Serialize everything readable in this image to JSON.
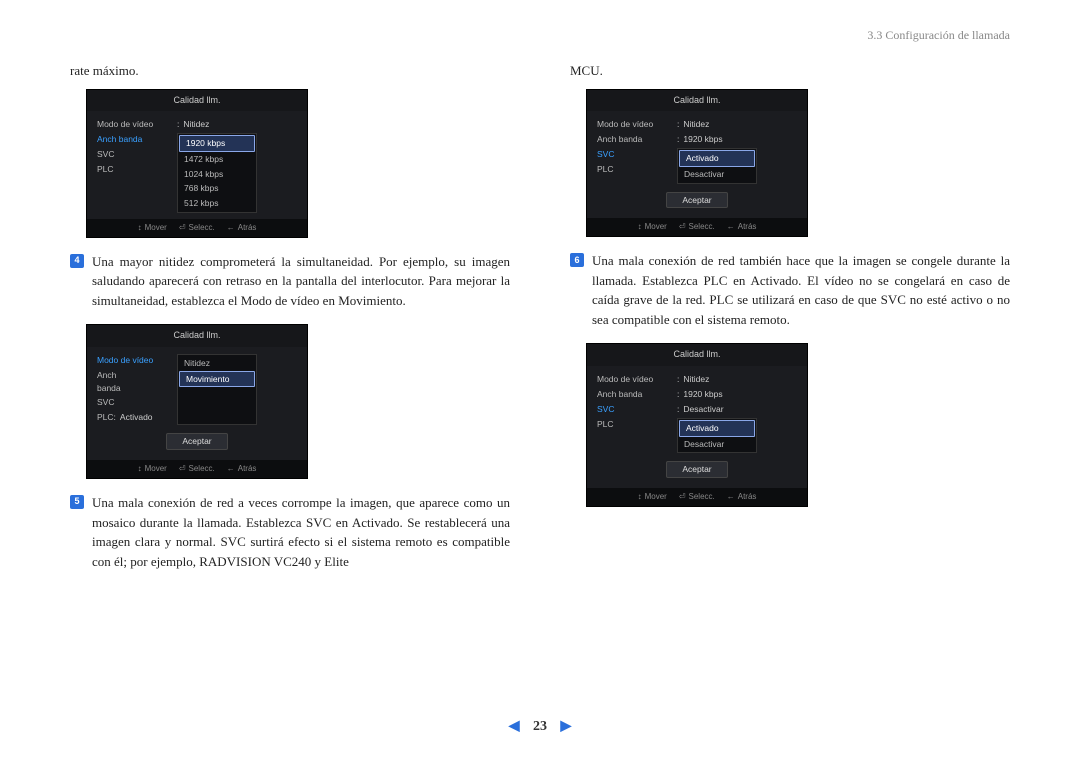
{
  "header": {
    "section": "3.3 Configuración de llamada"
  },
  "leftCol": {
    "lead1": "rate máximo.",
    "shot1": {
      "title": "Calidad  llm.",
      "rows": [
        {
          "label": "Modo de vídeo",
          "value": "Nitidez",
          "hl": false
        },
        {
          "label": "Anch banda",
          "value": "",
          "hl": true
        }
      ],
      "dropdown": [
        "1920 kbps",
        "1472 kbps",
        "1024 kbps",
        "768 kbps",
        "512 kbps"
      ],
      "selectedIndex": 0,
      "extraRows": [
        {
          "label": "SVC",
          "value": ""
        },
        {
          "label": "PLC",
          "value": ""
        }
      ],
      "footer": {
        "move": "Mover",
        "select": "Selecc.",
        "back": "Atrás"
      }
    },
    "step4": {
      "num": "4",
      "text": "Una mayor nitidez comprometerá la simultaneidad. Por ejemplo, su imagen saludando aparecerá con retraso en la pantalla del interlocutor. Para mejorar la simultaneidad, establezca el Modo de vídeo en Movi­miento."
    },
    "shot2": {
      "title": "Calidad  llm.",
      "rows": [
        {
          "label": "Modo de vídeo",
          "value": "",
          "hl": true
        }
      ],
      "dropdown": [
        "Nitidez",
        "Movimiento"
      ],
      "selectedIndex": 1,
      "extraRows": [
        {
          "label": "Anch banda",
          "value": ""
        },
        {
          "label": "SVC",
          "value": ""
        },
        {
          "label": "PLC",
          "value": "Activado"
        }
      ],
      "accept": "Aceptar",
      "footer": {
        "move": "Mover",
        "select": "Selecc.",
        "back": "Atrás"
      }
    },
    "step5": {
      "num": "5",
      "text": "Una mala conexión de red a veces corrompe la imagen, que aparece como un mosaico durante la llamada. Establezca SVC en Activado. Se restablecerá una imagen clara y normal. SVC surtirá efecto si el sistema remoto es compatible con él; por ejemplo, RADVISION VC240 y Elite"
    }
  },
  "rightCol": {
    "lead1": "MCU.",
    "shot3": {
      "title": "Calidad  llm.",
      "rows": [
        {
          "label": "Modo de vídeo",
          "value": "Nitidez",
          "hl": false
        },
        {
          "label": "Anch banda",
          "value": "1920 kbps",
          "hl": false
        },
        {
          "label": "SVC",
          "value": "",
          "hl": true
        }
      ],
      "dropdown": [
        "Activado",
        "Desactivar"
      ],
      "selectedIndex": 0,
      "extraRows": [
        {
          "label": "PLC",
          "value": ""
        }
      ],
      "accept": "Aceptar",
      "footer": {
        "move": "Mover",
        "select": "Selecc.",
        "back": "Atrás"
      }
    },
    "step6": {
      "num": "6",
      "text": "Una mala conexión de red también hace que la imagen se congele du­rante la llamada. Establezca PLC en Activado. El vídeo no se congelará en caso de caída grave de la red. PLC se utilizará en caso de que SVC no esté activo o no sea compatible con el sistema remoto."
    },
    "shot4": {
      "title": "Calidad  llm.",
      "rows": [
        {
          "label": "Modo de vídeo",
          "value": "Nitidez",
          "hl": false
        },
        {
          "label": "Anch banda",
          "value": "1920 kbps",
          "hl": false
        },
        {
          "label": "SVC",
          "value": "Desactivar",
          "hl": true
        },
        {
          "label": "PLC",
          "value": "",
          "hl": false
        }
      ],
      "dropdown": [
        "Activado",
        "Desactivar"
      ],
      "selectedIndex": 0,
      "extraRows": [],
      "accept": "Aceptar",
      "footer": {
        "move": "Mover",
        "select": "Selecc.",
        "back": "Atrás"
      }
    }
  },
  "pager": {
    "page": "23"
  }
}
